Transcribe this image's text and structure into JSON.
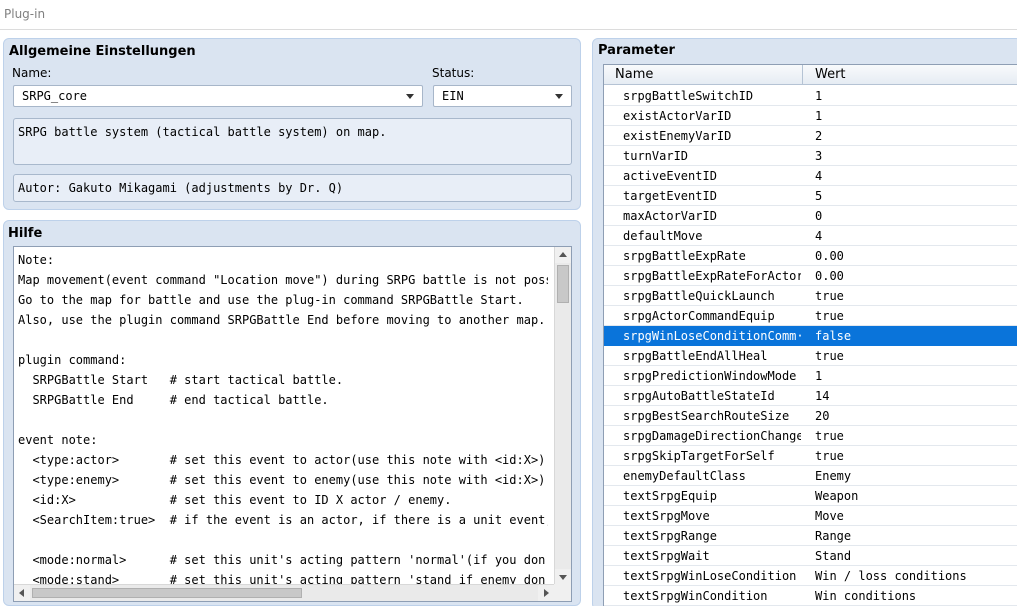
{
  "window": {
    "title": "Plug-in"
  },
  "general": {
    "title": "Allgemeine Einstellungen",
    "name_label": "Name:",
    "name_value": "SRPG_core",
    "status_label": "Status:",
    "status_value": "EIN",
    "description": "SRPG battle system (tactical battle system) on map.",
    "author": "Autor: Gakuto Mikagami (adjustments by Dr. Q)"
  },
  "help": {
    "title": "Hilfe",
    "text": "Note:\nMap movement(event command \"Location move\") during SRPG battle is not possible\nGo to the map for battle and use the plug-in command SRPGBattle Start.\nAlso, use the plugin command SRPGBattle End before moving to another map.\n\nplugin command:\n  SRPGBattle Start   # start tactical battle.\n  SRPGBattle End     # end tactical battle.\n\nevent note:\n  <type:actor>       # set this event to actor(use this note with <id:X>).\n  <type:enemy>       # set this event to enemy(use this note with <id:X>).\n  <id:X>             # set this event to ID X actor / enemy.\n  <SearchItem:true>  # if the event is an actor, if there is a unit event, it w\n\n  <mode:normal>      # set this unit's acting pattern 'normal'(if you don't se\n  <mode:stand>       # set this unit's acting pattern 'stand if enemy don't nea"
  },
  "parameters": {
    "title": "Parameter",
    "col_name": "Name",
    "col_value": "Wert",
    "rows": [
      {
        "name": "srpgBattleSwitchID",
        "value": "1"
      },
      {
        "name": "existActorVarID",
        "value": "1"
      },
      {
        "name": "existEnemyVarID",
        "value": "2"
      },
      {
        "name": "turnVarID",
        "value": "3"
      },
      {
        "name": "activeEventID",
        "value": "4"
      },
      {
        "name": "targetEventID",
        "value": "5"
      },
      {
        "name": "maxActorVarID",
        "value": "0"
      },
      {
        "name": "defaultMove",
        "value": "4"
      },
      {
        "name": "srpgBattleExpRate",
        "value": "0.00"
      },
      {
        "name": "srpgBattleExpRateForActors",
        "value": "0.00"
      },
      {
        "name": "srpgBattleQuickLaunch",
        "value": "true"
      },
      {
        "name": "srpgActorCommandEquip",
        "value": "true"
      },
      {
        "name": "srpgWinLoseConditionComm···",
        "value": "false",
        "selected": true
      },
      {
        "name": "srpgBattleEndAllHeal",
        "value": "true"
      },
      {
        "name": "srpgPredictionWindowMode",
        "value": "1"
      },
      {
        "name": "srpgAutoBattleStateId",
        "value": "14"
      },
      {
        "name": "srpgBestSearchRouteSize",
        "value": "20"
      },
      {
        "name": "srpgDamageDirectionChange",
        "value": "true"
      },
      {
        "name": "srpgSkipTargetForSelf",
        "value": "true"
      },
      {
        "name": "enemyDefaultClass",
        "value": "Enemy"
      },
      {
        "name": "textSrpgEquip",
        "value": "Weapon"
      },
      {
        "name": "textSrpgMove",
        "value": "Move"
      },
      {
        "name": "textSrpgRange",
        "value": "Range"
      },
      {
        "name": "textSrpgWait",
        "value": "Stand"
      },
      {
        "name": "textSrpgWinLoseCondition",
        "value": "Win / loss conditions"
      },
      {
        "name": "textSrpgWinCondition",
        "value": "Win conditions"
      }
    ]
  },
  "colors": {
    "panel": "#dae4f1",
    "selection": "#0a74da"
  }
}
